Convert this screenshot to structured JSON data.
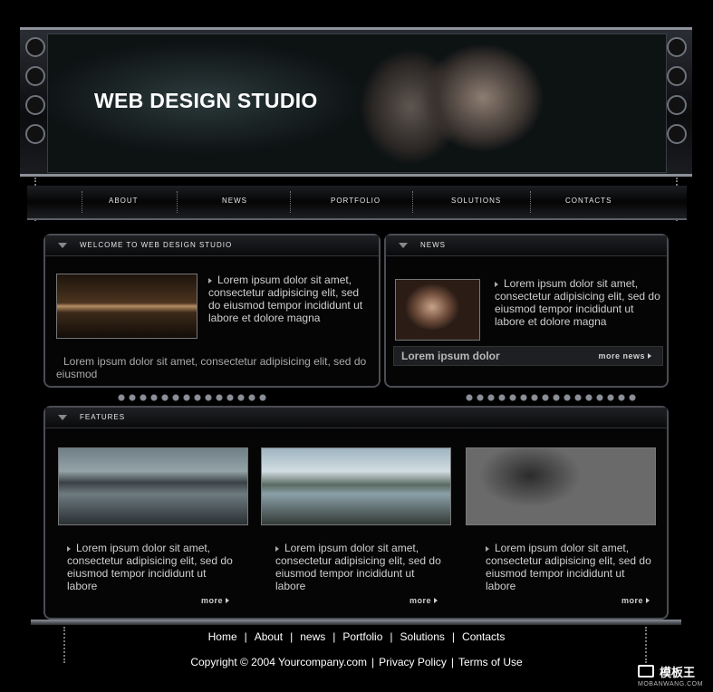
{
  "header": {
    "site_title": "WEB DESIGN STUDIO"
  },
  "nav": {
    "items": [
      {
        "label": "ABOUT"
      },
      {
        "label": "NEWS"
      },
      {
        "label": "PORTFOLIO"
      },
      {
        "label": "SOLUTIONS"
      },
      {
        "label": "CONTACTS"
      }
    ]
  },
  "welcome": {
    "title": "WELCOME TO WEB DESIGN STUDIO",
    "text": "Lorem ipsum dolor sit amet, consectetur adipisicing elit, sed do eiusmod tempor incididunt ut labore et dolore magna",
    "caption": "Lorem ipsum dolor sit amet, consectetur adipisicing elit, sed do eiusmod"
  },
  "news": {
    "title": "NEWS",
    "text": "Lorem ipsum dolor sit amet, consectetur adipisicing elit, sed do eiusmod tempor incididunt ut labore et dolore magna",
    "headline": "Lorem ipsum dolor",
    "more": "more news"
  },
  "features": {
    "title": "FEATURES",
    "items": [
      {
        "text": "Lorem ipsum dolor sit amet, consectetur adipisicing elit, sed do eiusmod tempor incididunt ut labore",
        "more": "more"
      },
      {
        "text": "Lorem ipsum dolor sit amet, consectetur adipisicing elit, sed do eiusmod tempor incididunt ut labore",
        "more": "more"
      },
      {
        "text": "Lorem ipsum dolor sit amet, consectetur adipisicing elit, sed do eiusmod tempor incididunt ut labore",
        "more": "more"
      }
    ]
  },
  "footer": {
    "links": [
      "Home",
      "About",
      "news",
      "Portfolio",
      "Solutions",
      "Contacts"
    ],
    "separator": "|",
    "copyright": "Copyright © 2004 Yourcompany.com",
    "privacy": "Privacy Policy",
    "terms": "Terms of Use"
  },
  "watermark": {
    "brand": "模板王",
    "url": "MOBANWANG.COM"
  }
}
